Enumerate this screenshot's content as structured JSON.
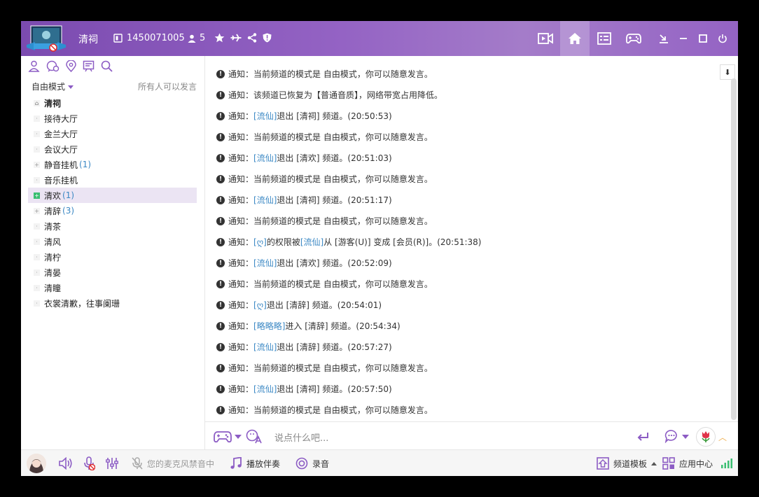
{
  "header": {
    "channel_name": "清祠",
    "channel_id": "1450071005",
    "online_count": "5"
  },
  "left": {
    "mode_label": "自由模式",
    "mode_note": "所有人可以发言",
    "tree": [
      {
        "name": "清祠",
        "count": "",
        "root": true
      },
      {
        "name": "接待大厅",
        "count": ""
      },
      {
        "name": "金兰大厅",
        "count": ""
      },
      {
        "name": "会议大厅",
        "count": ""
      },
      {
        "name": "静音挂机",
        "count": "(1)",
        "expandable": true
      },
      {
        "name": "音乐挂机",
        "count": ""
      },
      {
        "name": "清欢",
        "count": "(1)",
        "selected": true
      },
      {
        "name": "清辞",
        "count": "(3)",
        "expandable": true
      },
      {
        "name": "清茶",
        "count": ""
      },
      {
        "name": "清风",
        "count": ""
      },
      {
        "name": "清柠",
        "count": ""
      },
      {
        "name": "清晏",
        "count": ""
      },
      {
        "name": "清瞳",
        "count": ""
      },
      {
        "name": "衣裳清歉，往事阑珊",
        "count": ""
      }
    ]
  },
  "chat": {
    "prefix": "通知：",
    "messages": [
      {
        "parts": [
          {
            "t": "当前频道的模式是 自由模式，你可以随意发言。"
          }
        ]
      },
      {
        "parts": [
          {
            "t": "该频道已恢复为【普通音质】，网络带宽占用降低。"
          }
        ]
      },
      {
        "parts": [
          {
            "t": "[流仙]",
            "link": true
          },
          {
            "t": " 退出 [清祠] 频道。(20:50:53)"
          }
        ]
      },
      {
        "parts": [
          {
            "t": "当前频道的模式是 自由模式，你可以随意发言。"
          }
        ]
      },
      {
        "parts": [
          {
            "t": "[流仙]",
            "link": true
          },
          {
            "t": " 退出 [清欢] 频道。(20:51:03)"
          }
        ]
      },
      {
        "parts": [
          {
            "t": "当前频道的模式是 自由模式，你可以随意发言。"
          }
        ]
      },
      {
        "parts": [
          {
            "t": "[流仙]",
            "link": true
          },
          {
            "t": " 退出 [清祠] 频道。(20:51:17)"
          }
        ]
      },
      {
        "parts": [
          {
            "t": "当前频道的模式是 自由模式，你可以随意发言。"
          }
        ]
      },
      {
        "parts": [
          {
            "t": "[ღ]",
            "link": true
          },
          {
            "t": " 的权限被 "
          },
          {
            "t": "[流仙]",
            "link": true
          },
          {
            "t": " 从 [游客(U)] 变成 [会员(R)]。(20:51:38)"
          }
        ]
      },
      {
        "parts": [
          {
            "t": "[流仙]",
            "link": true
          },
          {
            "t": " 退出 [清欢] 频道。(20:52:09)"
          }
        ]
      },
      {
        "parts": [
          {
            "t": "当前频道的模式是 自由模式，你可以随意发言。"
          }
        ]
      },
      {
        "parts": [
          {
            "t": "[ღ]",
            "link": true
          },
          {
            "t": " 退出 [清辞] 频道。(20:54:01)"
          }
        ]
      },
      {
        "parts": [
          {
            "t": "[略略略]",
            "link": true
          },
          {
            "t": " 进入 [清辞] 频道。(20:54:34)"
          }
        ]
      },
      {
        "parts": [
          {
            "t": "[流仙]",
            "link": true
          },
          {
            "t": " 退出 [清辞] 频道。(20:57:27)"
          }
        ]
      },
      {
        "parts": [
          {
            "t": "当前频道的模式是 自由模式，你可以随意发言。"
          }
        ]
      },
      {
        "parts": [
          {
            "t": "[流仙]",
            "link": true
          },
          {
            "t": " 退出 [清祠] 频道。(20:57:50)"
          }
        ]
      },
      {
        "parts": [
          {
            "t": "当前频道的模式是 自由模式，你可以随意发言。"
          }
        ]
      }
    ]
  },
  "input": {
    "placeholder": "说点什么吧..."
  },
  "bottom": {
    "mic_muted_note": "您的麦克风禁音中",
    "play_accompaniment": "播放伴奏",
    "record": "录音",
    "channel_template": "频道模板",
    "app_center": "应用中心"
  },
  "colors": {
    "accent": "#8c5cc4",
    "header_gradient_start": "#7b4bb0",
    "link": "#3b88c4",
    "selected_row": "#ebe4f3"
  }
}
